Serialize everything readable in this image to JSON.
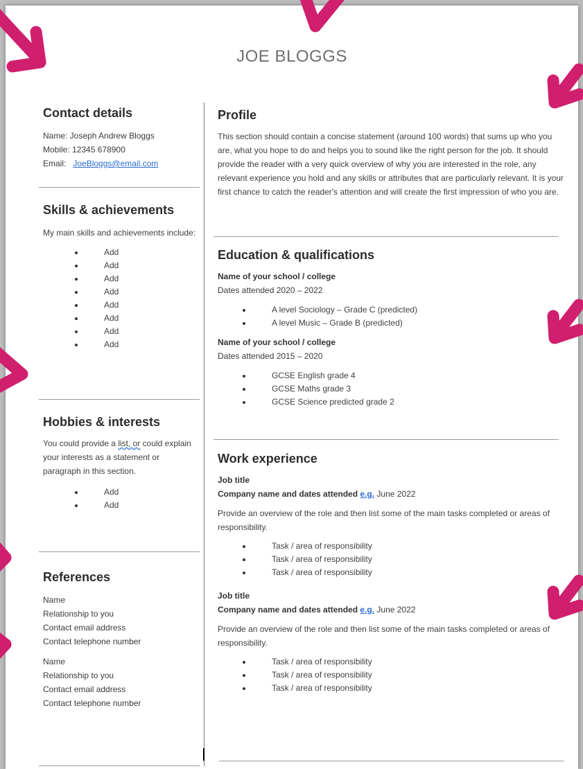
{
  "name": "JOE BLOGGS",
  "contact": {
    "heading": "Contact details",
    "name_line": "Name:   Joseph Andrew Bloggs",
    "mobile_line": "Mobile: 12345 678900",
    "email_label": "Email:",
    "email_value": "JoeBloggs@email.com"
  },
  "skills": {
    "heading": "Skills & achievements",
    "intro": "My main skills and achievements include:",
    "items": [
      "Add",
      "Add",
      "Add",
      "Add",
      "Add",
      "Add",
      "Add",
      "Add"
    ]
  },
  "hobbies": {
    "heading": "Hobbies & interests",
    "text_before": "You could provide a ",
    "text_flagged": "list, or",
    "text_after": " could explain your interests as a statement or paragraph in this section.",
    "items": [
      "Add",
      "Add"
    ]
  },
  "references": {
    "heading": "References",
    "blocks": [
      [
        "Name",
        "Relationship to you",
        "Contact email address",
        "Contact telephone number"
      ],
      [
        "Name",
        "Relationship to you",
        "Contact email address",
        "Contact telephone number"
      ]
    ]
  },
  "profile": {
    "heading": "Profile",
    "text": "This section should contain a concise statement (around 100 words) that sums up who you are, what you hope to do and helps you to sound like the right person for the job. It should provide the reader with a very quick overview of why you are interested in the role, any relevant experience you hold and any skills or attributes that are particularly relevant. It is your first chance to catch the reader's attention and will create the first impression of who you are."
  },
  "education": {
    "heading": "Education & qualifications",
    "schools": [
      {
        "name": "Name of your school / college",
        "dates": "Dates attended 2020 – 2022",
        "items": [
          "A level Sociology – Grade C (predicted)",
          "A level Music – Grade B (predicted)"
        ]
      },
      {
        "name": "Name of your school / college",
        "dates": "Dates attended 2015 – 2020",
        "items": [
          "GCSE English grade 4",
          "GCSE Maths grade 3",
          "GCSE Science predicted grade 2"
        ]
      }
    ]
  },
  "work": {
    "heading": "Work experience",
    "jobs": [
      {
        "title": "Job title",
        "company": "Company name and dates attended ",
        "eg": "e.g.",
        "date": " June 2022",
        "overview": "Provide an overview of the role and then list some of the main tasks completed or areas of responsibility.",
        "tasks": [
          "Task / area of responsibility",
          "Task / area of responsibility",
          "Task / area of responsibility"
        ]
      },
      {
        "title": "Job title",
        "company": "Company name and dates attended ",
        "eg": "e.g.",
        "date": " June 2022",
        "overview": "Provide an overview of the role and then list some of the main tasks completed or areas of responsibility.",
        "tasks": [
          "Task / area of responsibility",
          "Task / area of responsibility",
          "Task / area of responsibility"
        ]
      }
    ]
  },
  "colors": {
    "arrow": "#d01f6e",
    "link": "#2a6bd0"
  }
}
